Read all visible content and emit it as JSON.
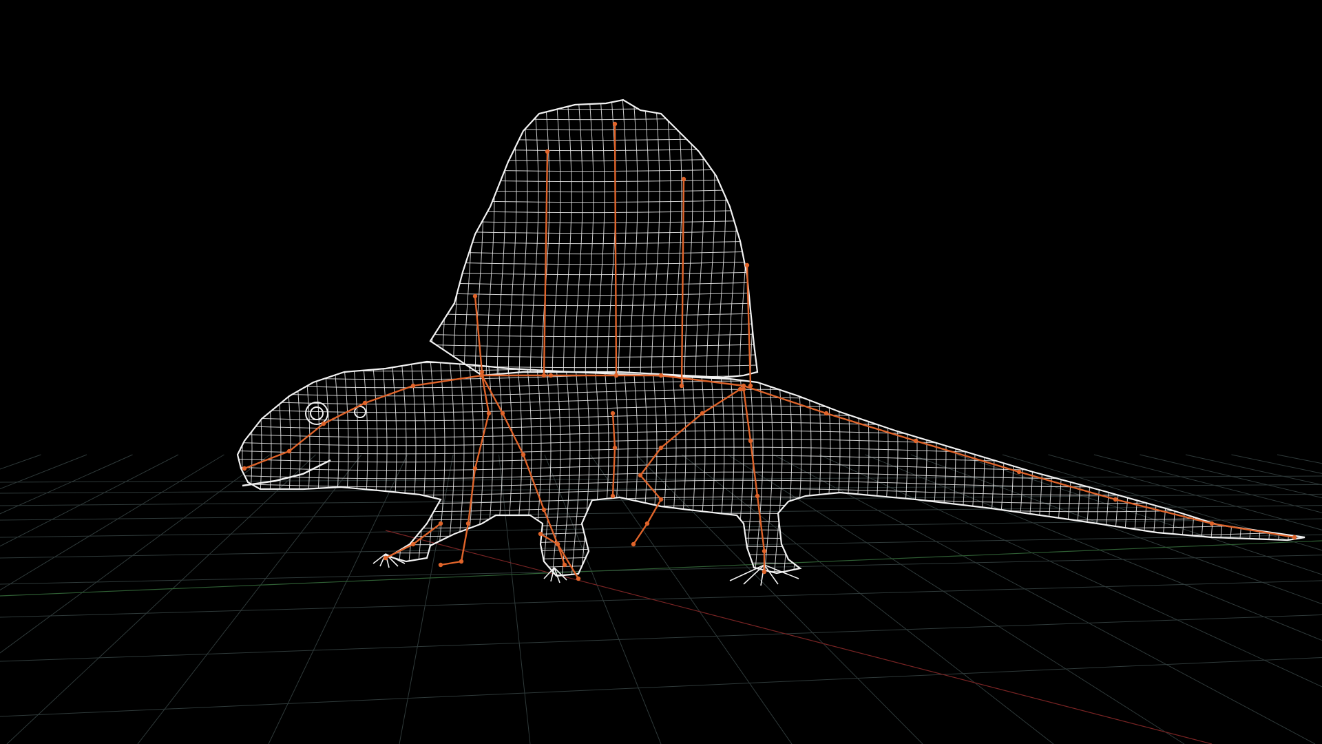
{
  "viewport": {
    "view": "perspective",
    "display_mode": "wireframe",
    "subject": "dimetrodon-model",
    "background_color": "#000000",
    "grid_color": "#2f3a3a",
    "axis_x_color": "#7a2424",
    "axis_z_color": "#2f5f34",
    "mesh_color": "#f2f2f2",
    "rig_color": "#e0642a",
    "icons": {
      "grid": "ground-grid",
      "mesh": "wireframe-mesh",
      "rig": "skeleton-rig"
    }
  }
}
